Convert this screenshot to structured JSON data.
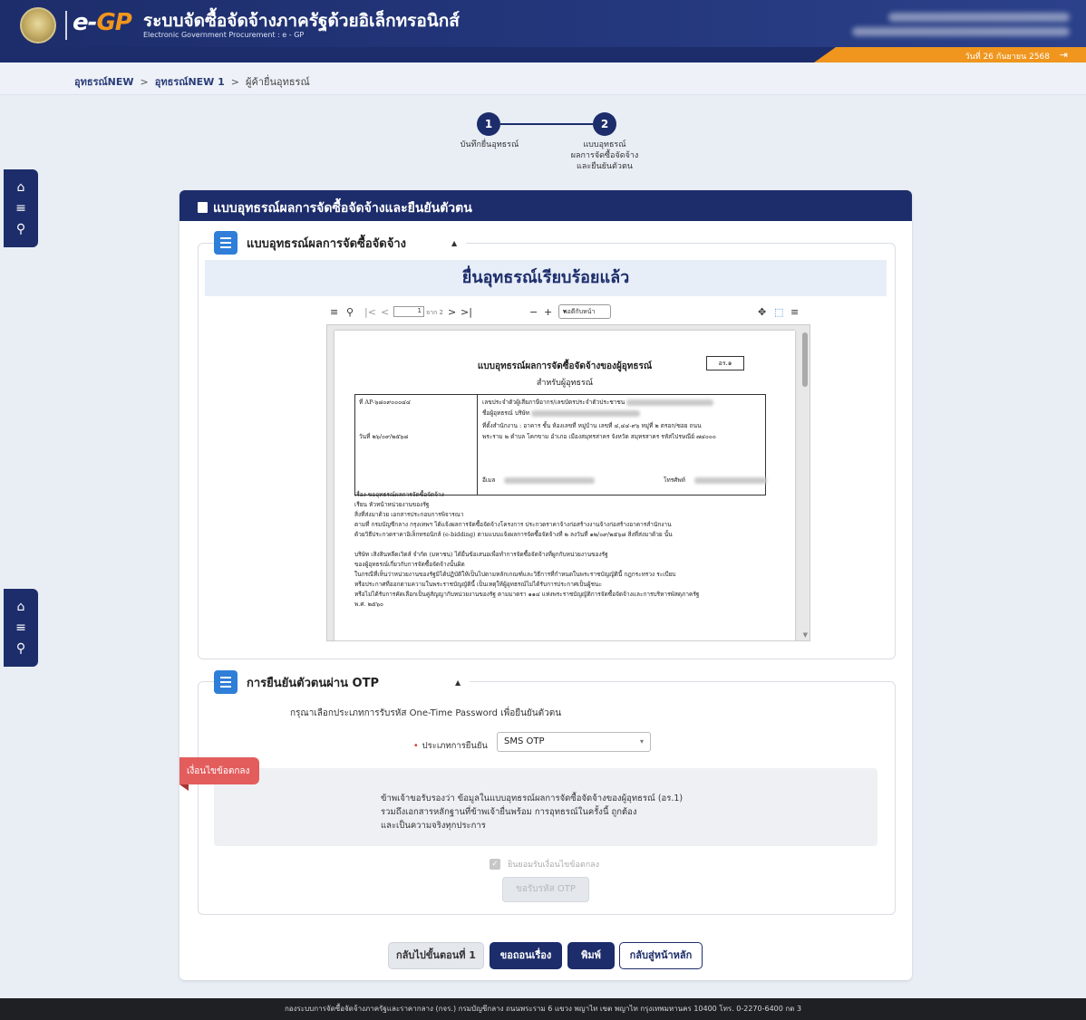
{
  "header": {
    "logo_text_e": "e-",
    "logo_text_gp": "GP",
    "title": "ระบบจัดซื้อจัดจ้างภาครัฐด้วยอิเล็กทรอนิกส์",
    "subtitle": "Electronic Government Procurement : e - GP",
    "date": "วันที่ 26 กันยายน 2568",
    "colors": {
      "primary": "#1d2d6b",
      "accent": "#f0961e"
    }
  },
  "breadcrumb": [
    "อุทธรณ์NEW",
    "อุทธรณ์NEW 1",
    "ผู้ค้ายื่นอุทธรณ์"
  ],
  "stepper": [
    {
      "number": "1",
      "label": "บันทึกยื่นอุทธรณ์"
    },
    {
      "number": "2",
      "label_lines": [
        "แบบอุทธรณ์",
        "ผลการจัดซื้อจัดจ้าง",
        "และยืนยันตัวตน"
      ]
    }
  ],
  "card": {
    "title": "แบบอุทธรณ์ผลการจัดซื้อจัดจ้างและยืนยันตัวตน"
  },
  "section1": {
    "title": "แบบอุทธรณ์ผลการจัดซื้อจัดจ้าง",
    "success_message": "ยื่นอุทธรณ์เรียบร้อยแล้ว",
    "pdf": {
      "page_value": "1",
      "page_total": "จาก 2",
      "zoom": "พอดีกับหน้า",
      "doc_title": "แบบอุทธรณ์ผลการจัดซื้อจัดจ้างของผู้อุทธรณ์",
      "doc_subtitle": "สำหรับผู้อุทธรณ์",
      "doc_code": "อร.๑",
      "no_label": "ที่ AP-๖๘๐๙๐๐๐๔๔",
      "date_label": "วันที่ ๒๖/๐๙/๒๕๖๘",
      "taxid_label": "เลขประจำตัวผู้เสียภาษีอากร/เลขบัตรประจำตัวประชาชน",
      "company_label": "ชื่อผู้อุทธรณ์ บริษัท",
      "address_label": "ที่ตั้งสำนักงาน : อาคาร ชั้น ห้องเลขที่ หมู่บ้าน เลขที่ ๔,๔๔-๙๖ หมู่ที่ ๒ ตรอก/ซอย ถนน",
      "address_label2": "พระราม ๒ ตำบล โคกขาม อำเภอ เมืองสมุทรสาคร จังหวัด สมุทรสาคร รหัสไปรษณีย์ ๗๔๐๐๐",
      "email_label": "อีเมล",
      "phone_label": "โทรศัพท์",
      "body_lines": [
        "เรื่อง  ขออุทธรณ์ผลการจัดซื้อจัดจ้าง",
        "เรียน  หัวหน้าหน่วยงานของรัฐ",
        "สิ่งที่ส่งมาด้วย  เอกสารประกอบการพิจารณา",
        "          ตามที่ กรมบัญชีกลาง กรุงเทพฯ ได้แจ้งผลการจัดซื้อจัดจ้างโครงการ ประกวดราคาจ้างก่อสร้างงานจ้างก่อสร้างอาคารสำนักงาน",
        "ด้วยวิธีประกวดราคาอิเล็กทรอนิกส์ (e-bidding) ตามแบบแจ้งผลการจัดซื้อจัดจ้างที่ ๒ ลงวันที่ ๑๒/๐๙/๒๕๖๘ สิ่งที่ส่งมาด้วย นั้น",
        "",
        "          บริษัท เสิงสินหลีดเวิดส์ จำกัด (มหาชน) ได้ยื่นข้อเสนอเพื่อทำการจัดซื้อจัดจ้างที่ผูกกับหน่วยงานของรัฐ",
        "ของผู้อุทธรณ์เกี่ยวกับการจัดซื้อจัดจ้างนั้นผิด",
        "ในกรณีที่เห็นว่าหน่วยงานของรัฐมิได้ปฏิบัติให้เป็นไปตามหลักเกณฑ์และวิธีการที่กำหนดในพระราชบัญญัตินี้ กฎกระทรวง ระเบียบ",
        "หรือประกาศที่ออกตามความในพระราชบัญญัตินี้ เป็นเหตุให้ผู้อุทธรณ์ไม่ได้รับการประกาศเป็นผู้ชนะ",
        "หรือไม่ได้รับการคัดเลือกเป็นคู่สัญญากับหน่วยงานของรัฐ ตามมาตรา ๑๑๔ แห่งพระราชบัญญัติการจัดซื้อจัดจ้างและการบริหารพัสดุภาครัฐ",
        "พ.ศ. ๒๕๖๐"
      ]
    }
  },
  "section2": {
    "title": "การยืนยันตัวตนผ่าน OTP",
    "instruction": "กรุณาเลือกประเภทการรับรหัส One-Time Password เพื่อยืนยันตัวตน",
    "verify_type_label": "ประเภทการยืนยัน",
    "verify_type_value": "SMS OTP",
    "conditions_tag": "เงื่อนไขข้อตกลง",
    "conditions_lines": [
      "ข้าพเจ้าขอรับรองว่า ข้อมูลในแบบอุทธรณ์ผลการจัดซื้อจัดจ้างของผู้อุทธรณ์ (อร.1)",
      "รวมถึงเอกสารหลักฐานที่ข้าพเจ้ายื่นพร้อม การอุทธรณ์ในครั้งนี้ ถูกต้อง",
      "และเป็นความจริงทุกประการ"
    ],
    "agree_label": "ยินยอมรับเงื่อนไขข้อตกลง",
    "otp_button": "ขอรับรหัส OTP"
  },
  "actions": {
    "back_step1": "กลับไปขั้นตอนที่ 1",
    "withdraw": "ขอถอนเรื่อง",
    "print": "พิมพ์",
    "home": "กลับสู่หน้าหลัก"
  },
  "footer": "กองระบบการจัดซื้อจัดจ้างภาครัฐและราคากลาง (กจร.) กรมบัญชีกลาง ถนนพระราม 6 แขวง พญาไท เขต พญาไท กรุงเทพมหานคร 10400 โทร. 0-2270-6400 กด 3"
}
